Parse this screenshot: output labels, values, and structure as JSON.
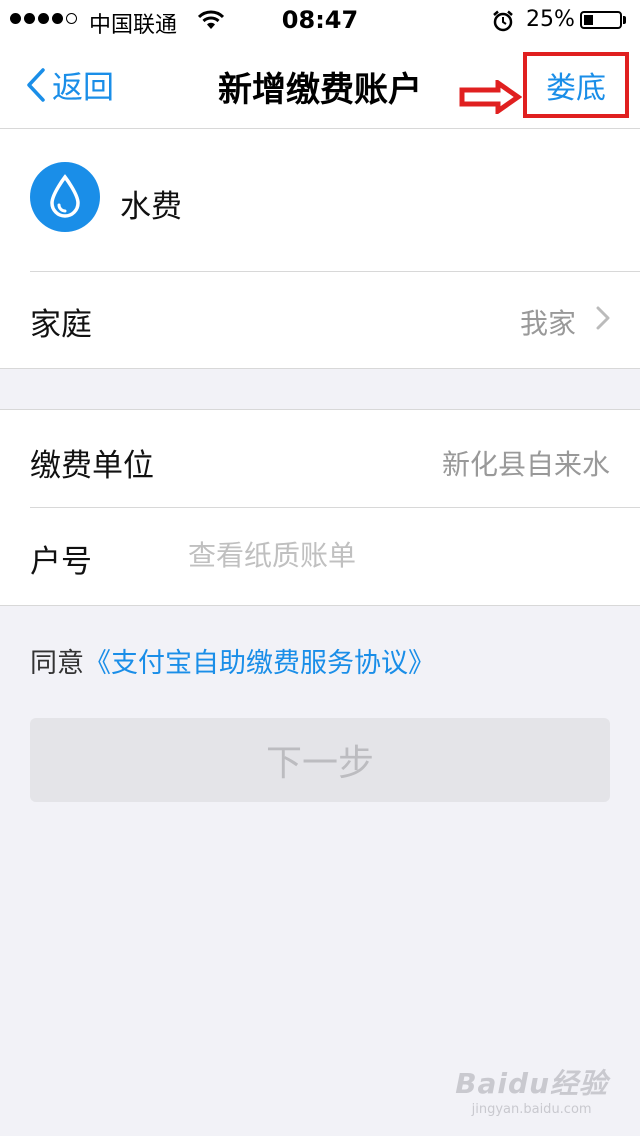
{
  "status_bar": {
    "carrier": "中国联通",
    "time": "08:47",
    "battery": "25%",
    "battery_level": 0.25
  },
  "nav": {
    "back_label": "返回",
    "title": "新增缴费账户",
    "city": "娄底"
  },
  "bill": {
    "type_label": "水费",
    "family_label": "家庭",
    "family_value": "我家"
  },
  "form": {
    "unit_label": "缴费单位",
    "unit_value": "新化县自来水",
    "account_label": "户号",
    "account_placeholder": "查看纸质账单",
    "account_value": ""
  },
  "agreement": {
    "prefix": "同意",
    "link": "《支付宝自助缴费服务协议》"
  },
  "next_button": "下一步",
  "watermark": {
    "logo": "Baidu经验",
    "url": "jingyan.baidu.com"
  },
  "colors": {
    "accent": "#1a8ee8",
    "highlight_box": "#e02020",
    "background": "#f2f2f7"
  }
}
